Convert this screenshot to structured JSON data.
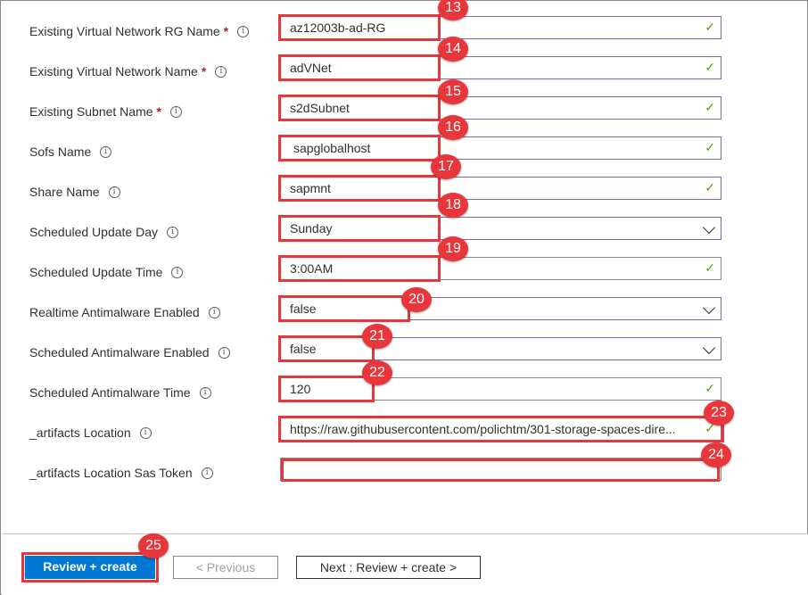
{
  "fields": [
    {
      "label": "Existing Virtual Network RG Name",
      "required": true,
      "value": "az12003b-ad-RG",
      "control": "check",
      "marker": "13"
    },
    {
      "label": "Existing Virtual Network Name",
      "required": true,
      "value": "adVNet",
      "control": "check",
      "marker": "14"
    },
    {
      "label": "Existing Subnet Name",
      "required": true,
      "value": "s2dSubnet",
      "control": "check",
      "marker": "15"
    },
    {
      "label": "Sofs Name",
      "required": false,
      "value": "sapglobalhost",
      "control": "check",
      "marker": "16"
    },
    {
      "label": "Share Name",
      "required": false,
      "value": "sapmnt",
      "control": "check",
      "marker": "17"
    },
    {
      "label": "Scheduled Update Day",
      "required": false,
      "value": "Sunday",
      "control": "dropdown",
      "marker": "18"
    },
    {
      "label": "Scheduled Update Time",
      "required": false,
      "value": "3:00AM",
      "control": "check",
      "marker": "19"
    },
    {
      "label": "Realtime Antimalware Enabled",
      "required": false,
      "value": "false",
      "control": "dropdown",
      "marker": "20"
    },
    {
      "label": "Scheduled Antimalware Enabled",
      "required": false,
      "value": "false",
      "control": "dropdown",
      "marker": "21"
    },
    {
      "label": "Scheduled Antimalware Time",
      "required": false,
      "value": "120",
      "control": "check",
      "marker": "22"
    },
    {
      "label": "_artifacts Location",
      "required": false,
      "value": "https://raw.githubusercontent.com/polichtm/301-storage-spaces-dire...",
      "control": "check",
      "marker": "23"
    },
    {
      "label": "_artifacts Location Sas Token",
      "required": false,
      "value": "",
      "control": "none",
      "marker": "24"
    }
  ],
  "footer": {
    "review_create_label": "Review + create",
    "previous_label": "< Previous",
    "next_label": "Next : Review + create >",
    "marker": "25"
  },
  "icons": {
    "info": "info-icon",
    "check": "checkmark-icon",
    "dropdown": "chevron-down-icon"
  },
  "colors": {
    "highlight": "#e8363b",
    "primary": "#0078d4",
    "valid": "#57a300",
    "focus_border": "#8764b8",
    "required": "#a4262c"
  }
}
